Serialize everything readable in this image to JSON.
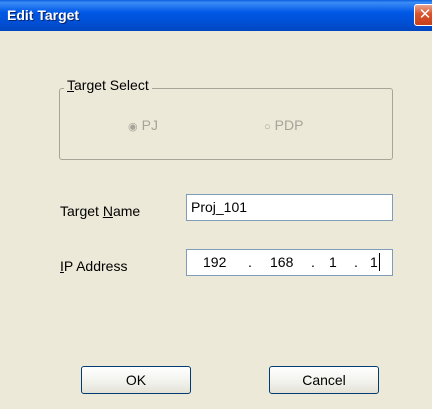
{
  "window": {
    "title": "Edit Target",
    "close_glyph": "✕"
  },
  "target_select": {
    "legend_prefix": "",
    "legend_mnemonic": "T",
    "legend_rest": "arget Select",
    "options": [
      {
        "label": "PJ",
        "selected": true,
        "enabled": false
      },
      {
        "label": "PDP",
        "selected": false,
        "enabled": false
      }
    ],
    "radio_selected_glyph": "◉",
    "radio_unselected_glyph": "○"
  },
  "target_name": {
    "label_prefix": "Target ",
    "label_mnemonic": "N",
    "label_rest": "ame",
    "value": "Proj_101"
  },
  "ip_address": {
    "label_mnemonic": "I",
    "label_rest": "P Address",
    "octets": [
      "192",
      "168",
      "1",
      "1"
    ],
    "separator": "."
  },
  "buttons": {
    "ok_label": "OK",
    "cancel_label": "Cancel"
  }
}
